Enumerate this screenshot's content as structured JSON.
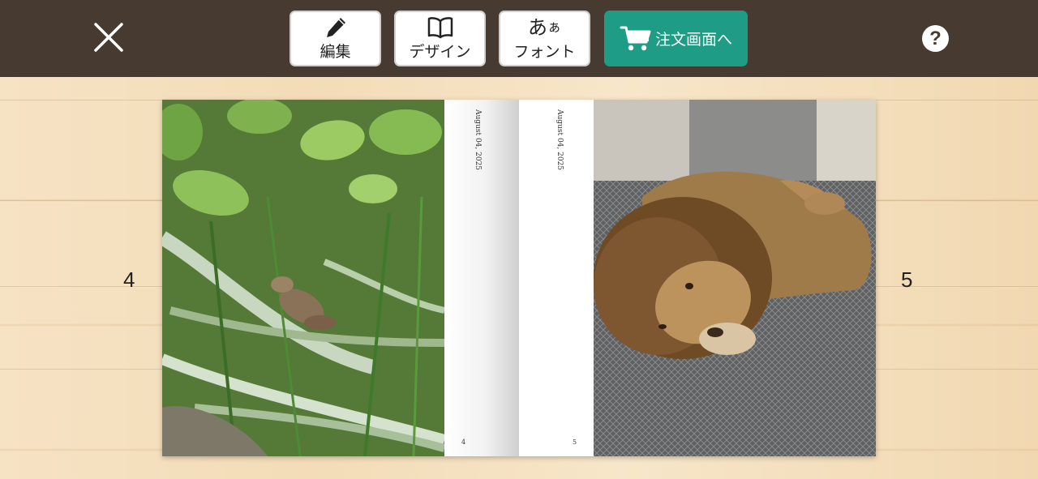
{
  "toolbar": {
    "edit_label": "編集",
    "design_label": "デザイン",
    "font_label": "フォント",
    "font_glyph_big": "あ",
    "font_glyph_small": "ぁ",
    "order_label": "注文画面へ",
    "help_label": "?",
    "icons": {
      "close": "close-icon",
      "edit": "pencil-icon",
      "design": "open-book-icon",
      "order": "cart-icon",
      "help": "question-icon"
    },
    "colors": {
      "bar": "#463a31",
      "order": "#1f9c85"
    }
  },
  "spread": {
    "left_page_number": "4",
    "right_page_number": "5",
    "left_inner": {
      "date": "August 04, 2025",
      "folio": "4"
    },
    "right_inner": {
      "date": "August 04, 2025",
      "folio": "5"
    }
  }
}
